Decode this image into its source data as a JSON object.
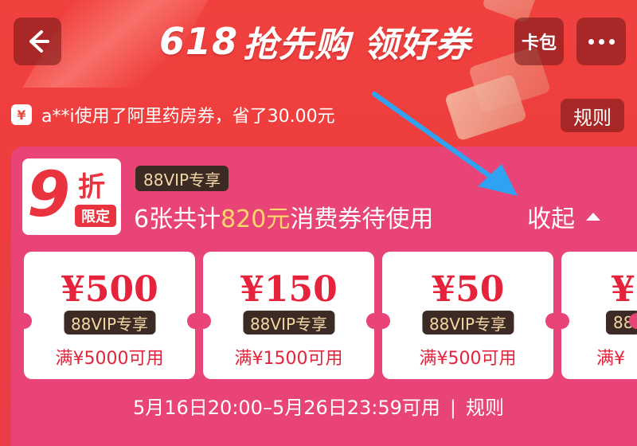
{
  "header": {
    "title_num": "618",
    "title_text": "抢先购 领好券",
    "card_label": "卡包"
  },
  "notice": {
    "icon_text": "¥",
    "text": "a**i使用了阿里药房券，省了30.00元",
    "rules_label": "规则"
  },
  "panel": {
    "badge_number": "9",
    "badge_unit": "折",
    "badge_limited": "限定",
    "vip_tag": "88VIP专享",
    "summary_prefix": "6张共计",
    "summary_amount": "820元",
    "summary_suffix": "消费券待使用",
    "collapse_label": "收起"
  },
  "coupons": [
    {
      "amount": "¥500",
      "tag": "88VIP专享",
      "condition": "满¥5000可用"
    },
    {
      "amount": "¥150",
      "tag": "88VIP专享",
      "condition": "满¥1500可用"
    },
    {
      "amount": "¥50",
      "tag": "88VIP专享",
      "condition": "满¥500可用"
    },
    {
      "amount": "¥",
      "tag": "88",
      "condition": "满¥"
    }
  ],
  "validity": {
    "range": "5月16日20:00–5月26日23:59可用",
    "separator": "|",
    "rules_link": "规则"
  },
  "colors": {
    "background": "#ee3d3d",
    "panel": "#e94477",
    "price_red": "#e5233b",
    "vip_tag_bg": "#3b2b24",
    "vip_tag_text": "#f4d6a4",
    "highlight": "#ffd66a",
    "annotation_arrow": "#2fa3f2"
  }
}
